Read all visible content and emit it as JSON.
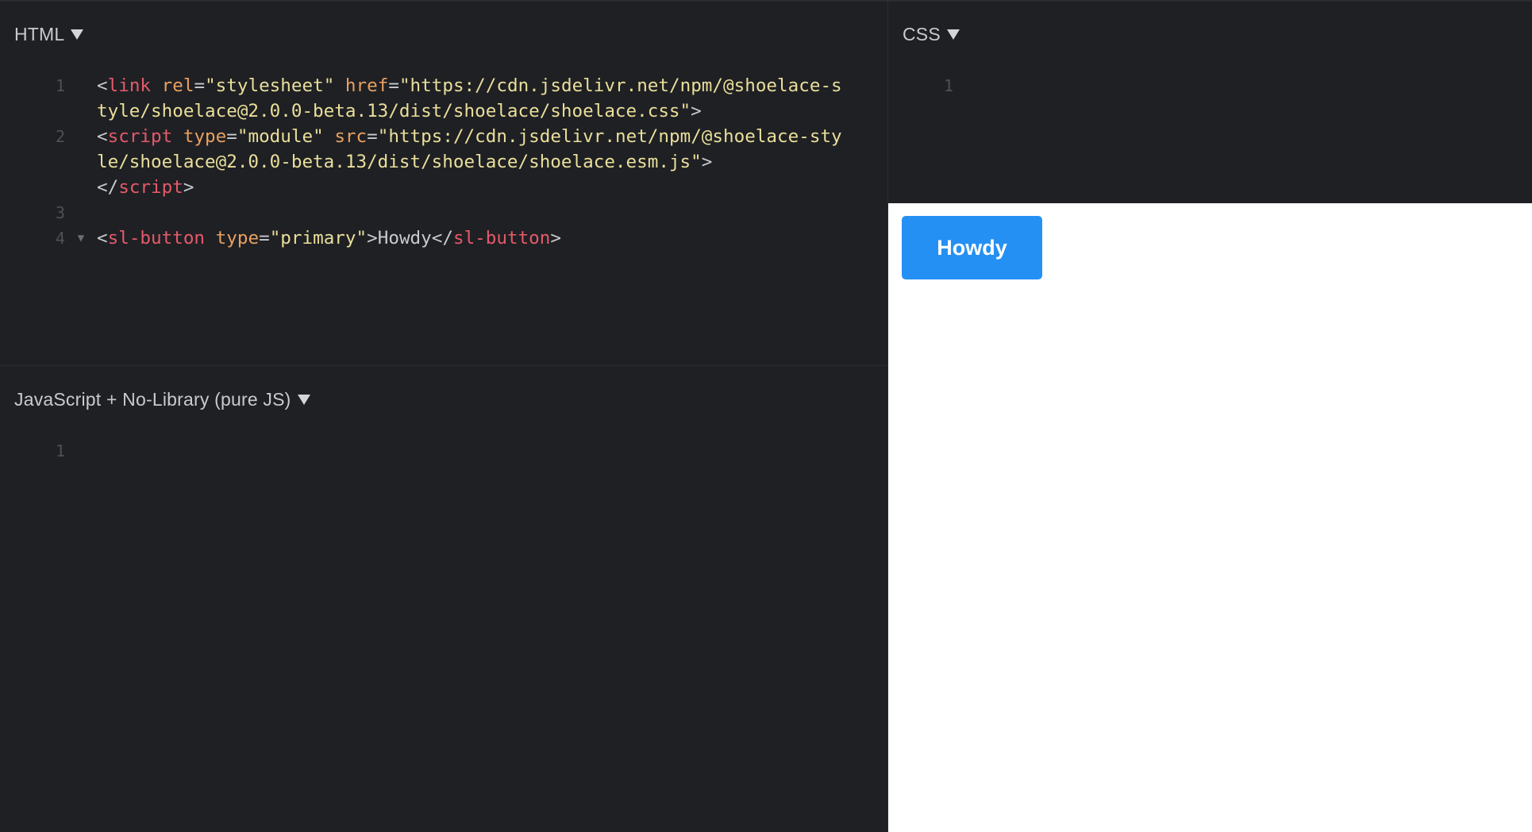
{
  "panes": {
    "html": {
      "title": "HTML",
      "lines": [
        {
          "num": "1",
          "fold": "",
          "tokens": [
            {
              "t": "<",
              "c": "punct"
            },
            {
              "t": "link",
              "c": "tag"
            },
            {
              "t": " ",
              "c": "punct"
            },
            {
              "t": "rel",
              "c": "attr"
            },
            {
              "t": "=",
              "c": "punct"
            },
            {
              "t": "\"stylesheet\"",
              "c": "str"
            },
            {
              "t": " ",
              "c": "punct"
            },
            {
              "t": "href",
              "c": "attr"
            },
            {
              "t": "=",
              "c": "punct"
            },
            {
              "t": "\"https://cdn.jsdelivr.net/npm/@shoelace-style/shoelace@2.0.0-beta.13/dist/shoelace/shoelace.css\"",
              "c": "str"
            },
            {
              "t": ">",
              "c": "punct"
            }
          ]
        },
        {
          "num": "2",
          "fold": "",
          "tokens": [
            {
              "t": "<",
              "c": "punct"
            },
            {
              "t": "script",
              "c": "tag"
            },
            {
              "t": " ",
              "c": "punct"
            },
            {
              "t": "type",
              "c": "attr"
            },
            {
              "t": "=",
              "c": "punct"
            },
            {
              "t": "\"module\"",
              "c": "str"
            },
            {
              "t": " ",
              "c": "punct"
            },
            {
              "t": "src",
              "c": "attr"
            },
            {
              "t": "=",
              "c": "punct"
            },
            {
              "t": "\"https://cdn.jsdelivr.net/npm/@shoelace-style/shoelace@2.0.0-beta.13/dist/shoelace/shoelace.esm.js\"",
              "c": "str"
            },
            {
              "t": ">",
              "c": "punct"
            },
            {
              "t": "\n",
              "c": "punct"
            },
            {
              "t": "</",
              "c": "punct"
            },
            {
              "t": "script",
              "c": "tag"
            },
            {
              "t": ">",
              "c": "punct"
            }
          ]
        },
        {
          "num": "3",
          "fold": "",
          "tokens": []
        },
        {
          "num": "4",
          "fold": "▼",
          "tokens": [
            {
              "t": "<",
              "c": "punct"
            },
            {
              "t": "sl-button",
              "c": "tag"
            },
            {
              "t": " ",
              "c": "punct"
            },
            {
              "t": "type",
              "c": "attr"
            },
            {
              "t": "=",
              "c": "punct"
            },
            {
              "t": "\"primary\"",
              "c": "str"
            },
            {
              "t": ">",
              "c": "punct"
            },
            {
              "t": "Howdy",
              "c": "text"
            },
            {
              "t": "</",
              "c": "punct"
            },
            {
              "t": "sl-button",
              "c": "tag"
            },
            {
              "t": ">",
              "c": "punct"
            }
          ]
        }
      ]
    },
    "css": {
      "title": "CSS",
      "lines": [
        {
          "num": "1",
          "fold": "",
          "tokens": []
        }
      ]
    },
    "js": {
      "title": "JavaScript + No-Library (pure JS)",
      "lines": [
        {
          "num": "1",
          "fold": "",
          "tokens": []
        }
      ]
    }
  },
  "preview": {
    "button_label": "Howdy"
  },
  "colors": {
    "editor_bg": "#1f2024",
    "tag": "#e55a6a",
    "attr": "#e9a060",
    "string": "#eadf9a",
    "button_bg": "#2590f3"
  }
}
